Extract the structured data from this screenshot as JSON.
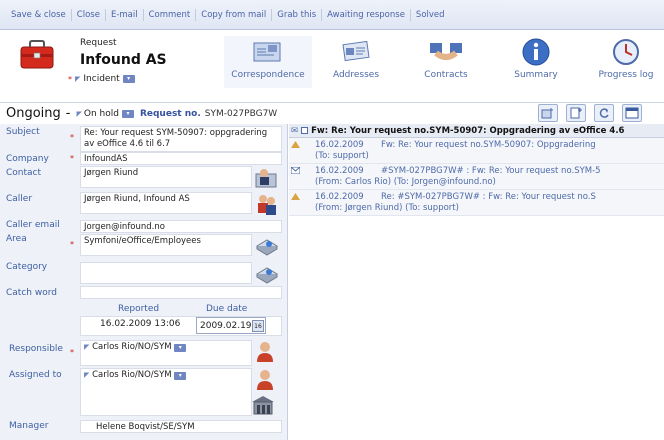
{
  "toolbar": {
    "items": [
      "Save & close",
      "Close",
      "E-mail",
      "Comment",
      "Copy from mail",
      "Grab this",
      "Awaiting response",
      "Solved"
    ]
  },
  "header": {
    "type_label": "Request",
    "customer": "Infound AS",
    "category": "Incident",
    "tabs": [
      {
        "label": "Correspondence",
        "icon": "envelope-icon"
      },
      {
        "label": "Addresses",
        "icon": "address-card-icon"
      },
      {
        "label": "Contracts",
        "icon": "handshake-icon"
      },
      {
        "label": "Summary",
        "icon": "info-icon"
      },
      {
        "label": "Progress log",
        "icon": "clock-icon"
      }
    ]
  },
  "status": {
    "label": "Ongoing",
    "sep": "-",
    "sub_status": "On hold",
    "reqno_label": "Request no.",
    "reqno": "SYM-027PBG7W"
  },
  "form": {
    "subject_label": "Subject",
    "subject": "Re: Your request SYM-50907: oppgradering av eOffice 4.6 til 6.7",
    "company_label": "Company",
    "company": "InfoundAS",
    "contact_label": "Contact",
    "contact": "Jørgen Riund",
    "caller_label": "Caller",
    "caller": "Jørgen Riund, Infound AS",
    "caller_email_label": "Caller email",
    "caller_email": "Jorgen@infound.no",
    "area_label": "Area",
    "area": "Symfoni/eOffice/Employees",
    "category_label": "Category",
    "category": "",
    "catchword_label": "Catch word",
    "catchword": "",
    "reported_label": "Reported",
    "reported": "16.02.2009 13:06",
    "due_label": "Due date",
    "due": "2009.02.19",
    "due_btn": "16",
    "responsible_label": "Responsible",
    "responsible": "Carlos Rio/NO/SYM",
    "assigned_label": "Assigned to",
    "assigned": "Carlos Rio/NO/SYM",
    "manager_label": "Manager",
    "manager": "Helene Boqvist/SE/SYM"
  },
  "mail": {
    "header": "Fw: Re: Your request no.SYM-50907: Oppgradering av eOffice 4.6",
    "rows": [
      {
        "date": "16.02.2009",
        "subject": "Fw: Re: Your request no.SYM-50907: Oppgradering",
        "party": "(To: support)",
        "icon": "outgoing-mail-icon"
      },
      {
        "date": "16.02.2009",
        "subject": "#SYM-027PBG7W# : Fw: Re: Your request no.SYM-5",
        "party": "(From: Carlos Rio)   (To: Jorgen@infound.no)",
        "icon": "incoming-mail-icon"
      },
      {
        "date": "16.02.2009",
        "subject": "Re: #SYM-027PBG7W# : Fw: Re: Your request no.S",
        "party": "(From: Jørgen Riund)   (To: support)",
        "icon": "outgoing-mail-icon"
      }
    ]
  }
}
